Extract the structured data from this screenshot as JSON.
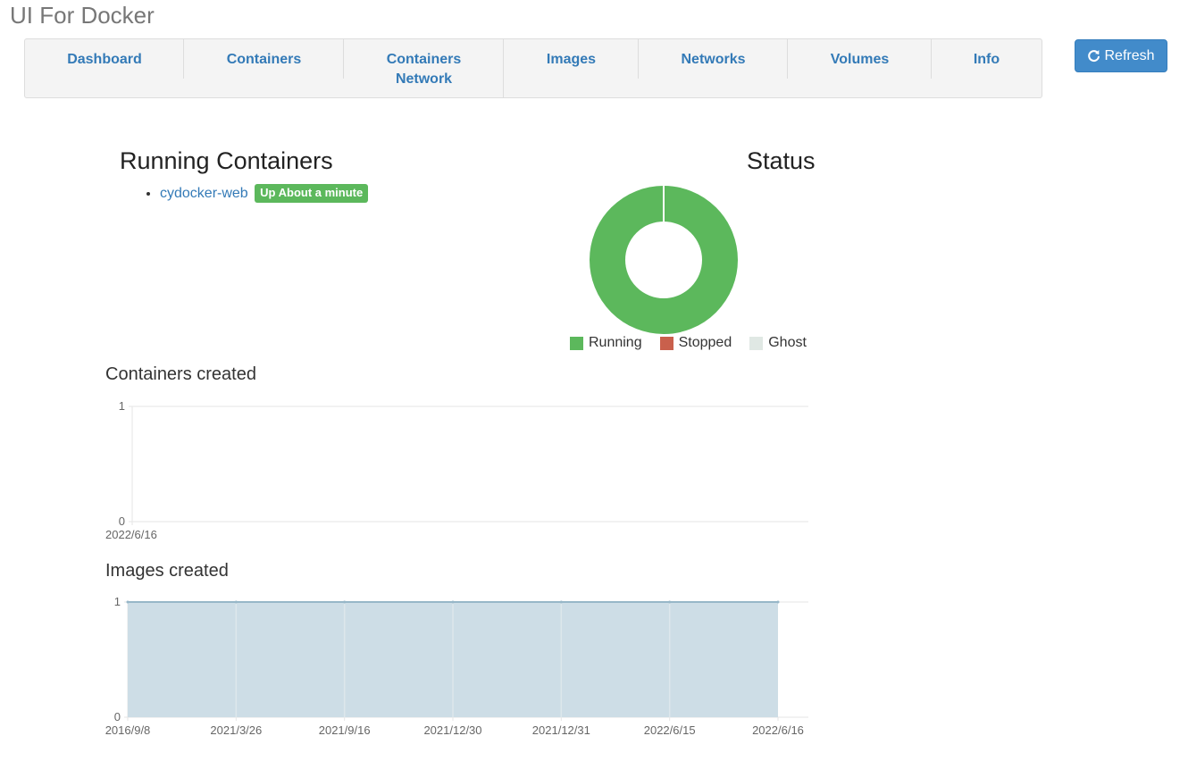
{
  "app": {
    "title": "UI For Docker"
  },
  "nav": {
    "tabs": [
      {
        "label": "Dashboard"
      },
      {
        "label_lines": [
          "Containers"
        ]
      },
      {
        "label_lines": [
          "Containers",
          "Network"
        ]
      },
      {
        "label": "Images"
      },
      {
        "label": "Networks"
      },
      {
        "label": "Volumes"
      },
      {
        "label": "Info"
      }
    ],
    "tab_containers": "Containers",
    "tab_containers_network_line1": "Containers",
    "tab_containers_network_line2": "Network"
  },
  "toolbar": {
    "refresh_label": "Refresh",
    "refresh_icon": "refresh-icon",
    "button_color": "#428bca"
  },
  "running": {
    "heading": "Running Containers",
    "containers": [
      {
        "name": "cydocker-web",
        "status": "Up About a minute"
      }
    ]
  },
  "status": {
    "heading": "Status",
    "legend": [
      {
        "label": "Running",
        "color": "#5cb85c"
      },
      {
        "label": "Stopped",
        "color": "#c9604c"
      },
      {
        "label": "Ghost",
        "color": "#e0e8e4"
      }
    ]
  },
  "chart_data": [
    {
      "type": "pie",
      "title": "Status",
      "donut": true,
      "labels": [
        "Running",
        "Stopped",
        "Ghost"
      ],
      "values": [
        1,
        0,
        0
      ],
      "colors": [
        "#5cb85c",
        "#c9604c",
        "#e0e8e4"
      ]
    },
    {
      "type": "line",
      "title": "Containers created",
      "x": [
        "2022/6/16"
      ],
      "series": [
        {
          "values": []
        }
      ],
      "ylim": [
        0,
        1
      ],
      "yticks": [
        0,
        1
      ],
      "grid": true
    },
    {
      "type": "area",
      "title": "Images created",
      "x": [
        "2016/9/8",
        "2021/3/26",
        "2021/9/16",
        "2021/12/30",
        "2021/12/31",
        "2022/6/15",
        "2022/6/16"
      ],
      "series": [
        {
          "values": [
            1,
            1,
            1,
            1,
            1,
            1,
            1
          ]
        }
      ],
      "ylim": [
        0,
        1
      ],
      "yticks": [
        0,
        1
      ],
      "fill_color": "#cddde6",
      "line_color": "#97b7c8",
      "grid": true
    }
  ]
}
